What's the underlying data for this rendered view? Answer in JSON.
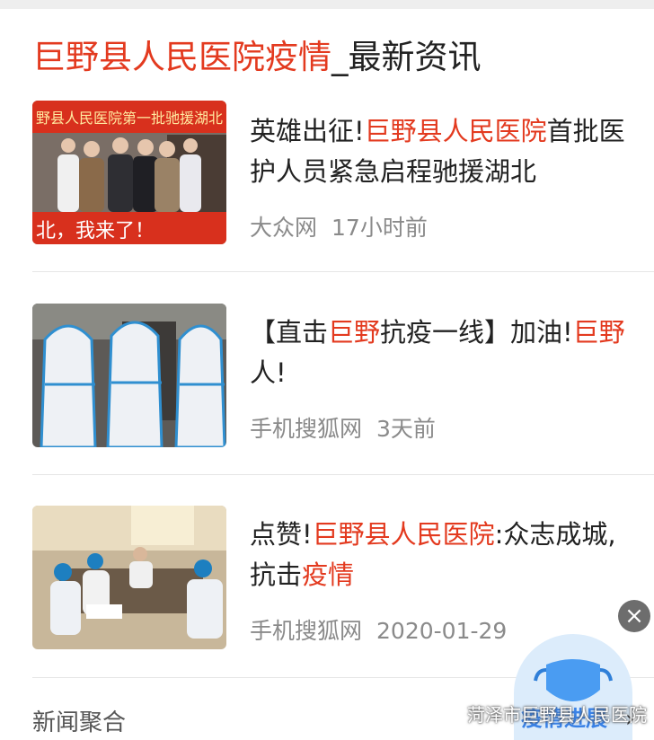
{
  "header": {
    "highlight": "巨野县人民医院疫情",
    "rest": "_最新资讯"
  },
  "articles": [
    {
      "title_parts": [
        {
          "text": "英雄出征!",
          "hl": false
        },
        {
          "text": "巨野县人民医院",
          "hl": true
        },
        {
          "text": "首批医护人员紧急启程驰援湖北",
          "hl": false
        }
      ],
      "source": "大众网",
      "time": "17小时前",
      "banner_text": "野县人民医院第一批驰援湖北",
      "caption_text": "北，我来了！"
    },
    {
      "title_parts": [
        {
          "text": "【直击",
          "hl": false
        },
        {
          "text": "巨野",
          "hl": true
        },
        {
          "text": "抗疫一线】加油!",
          "hl": false
        },
        {
          "text": "巨野",
          "hl": true
        },
        {
          "text": "人!",
          "hl": false
        }
      ],
      "source": "手机搜狐网",
      "time": "3天前"
    },
    {
      "title_parts": [
        {
          "text": "点赞!",
          "hl": false
        },
        {
          "text": "巨野县人民医院",
          "hl": true
        },
        {
          "text": ":众志成城,抗击",
          "hl": false
        },
        {
          "text": "疫情",
          "hl": true
        }
      ],
      "source": "手机搜狐网",
      "time": "2020-01-29"
    }
  ],
  "footer": {
    "label": "新闻聚合",
    "badge": "疫情进展",
    "close_icon": "close-icon",
    "chevron_icon": "chevron-right-icon"
  },
  "watermark": "菏泽市巨野县人民医院",
  "colors": {
    "accent": "#e33a1f",
    "text": "#222222",
    "meta": "#8a8a8a",
    "badge": "#3a82e6"
  }
}
